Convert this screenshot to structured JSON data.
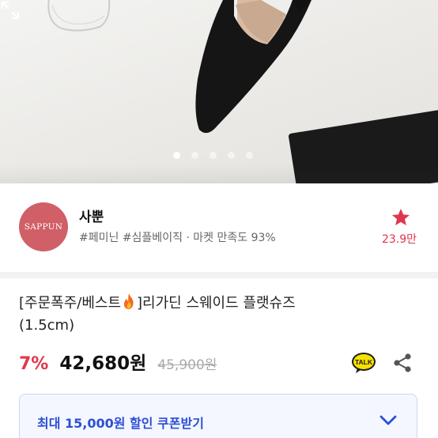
{
  "product_image": {
    "carousel_dot_count": 5,
    "active_dot_index": 0,
    "expand_icon": "expand-icon"
  },
  "seller": {
    "avatar_text": "SAPPUN",
    "avatar_color": "#d15f67",
    "name": "사뿐",
    "tags": "#페미닌 #심플베이직 · 마켓 만족도 93%",
    "like_icon": "star-icon",
    "like_count": "23.9만",
    "accent_color": "#e0364b"
  },
  "product": {
    "title_prefix": "[주문폭주/베스트",
    "title_icon": "fire-icon",
    "title_suffix": "]리가딘 스웨이드 플랫슈즈",
    "title_line2": "(1.5cm)",
    "discount": "7%",
    "price": "42,680원",
    "original_price": "45,900원",
    "talk_icon_text": "TALK",
    "share_icon": "share-icon"
  },
  "coupon": {
    "label": "최대 15,000원 할인 쿠폰받기",
    "chevron_icon": "chevron-down-icon",
    "color": "#2c4fd6"
  }
}
